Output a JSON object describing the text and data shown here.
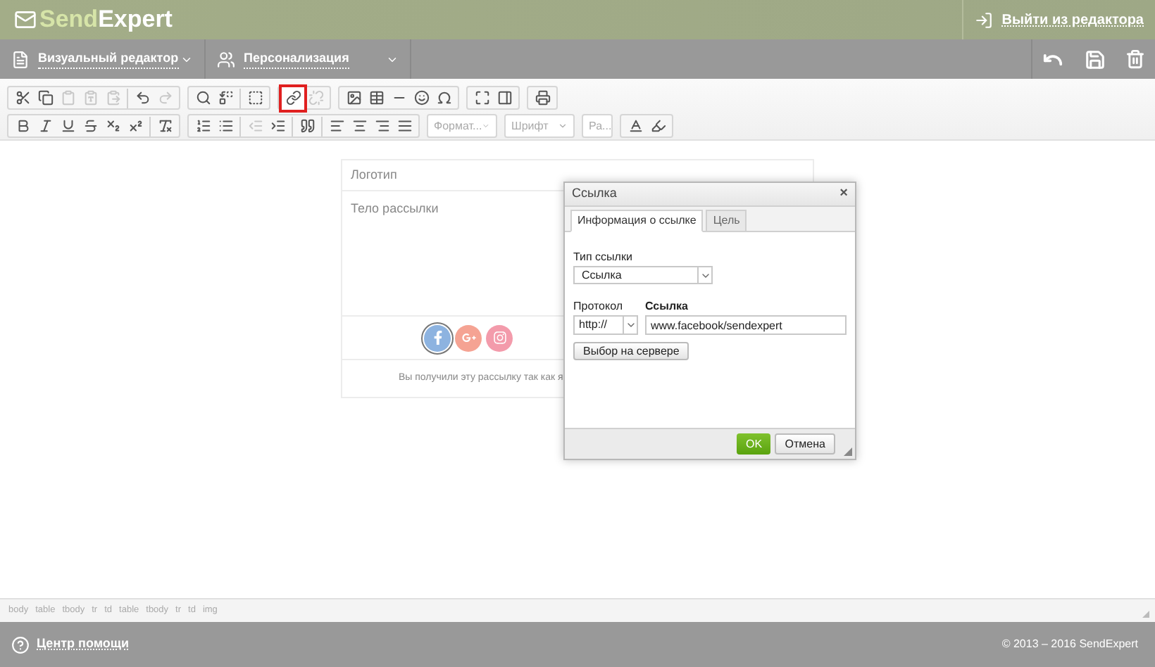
{
  "header": {
    "brand_prefix": "Send",
    "brand_suffix": "Expert",
    "exit_link": "Выйти из редактора"
  },
  "menu_bar": {
    "items": [
      {
        "kind": "editor",
        "label": "Визуальный редактор"
      },
      {
        "kind": "people",
        "label": "Персонализация"
      }
    ]
  },
  "toolbar": {
    "rows": [
      [
        {
          "items": [
            {
              "kind": "cut",
              "disabled": false,
              "selected": false
            },
            {
              "kind": "copy",
              "disabled": false,
              "selected": false
            },
            {
              "kind": "paste",
              "disabled": true,
              "selected": false
            },
            {
              "kind": "paste-text",
              "disabled": true,
              "selected": false
            },
            {
              "kind": "paste-word",
              "disabled": true,
              "selected": false
            },
            {
              "kind": "sep"
            },
            {
              "kind": "undo",
              "disabled": false,
              "selected": false
            },
            {
              "kind": "redo",
              "disabled": true,
              "selected": false
            }
          ]
        },
        {
          "items": [
            {
              "kind": "find",
              "disabled": false,
              "selected": false
            },
            {
              "kind": "replace",
              "disabled": false,
              "selected": false
            },
            {
              "kind": "sep"
            },
            {
              "kind": "select-all",
              "disabled": false,
              "selected": false
            }
          ]
        },
        {
          "items": [
            {
              "kind": "link",
              "disabled": false,
              "selected": true
            },
            {
              "kind": "unlink",
              "disabled": true,
              "selected": false
            }
          ]
        },
        {
          "items": [
            {
              "kind": "image",
              "disabled": false,
              "selected": false
            },
            {
              "kind": "table",
              "disabled": false,
              "selected": false
            },
            {
              "kind": "hr",
              "disabled": false,
              "selected": false
            },
            {
              "kind": "smiley",
              "disabled": false,
              "selected": false
            },
            {
              "kind": "omega",
              "disabled": false,
              "selected": false
            }
          ]
        },
        {
          "items": [
            {
              "kind": "maximize",
              "disabled": false,
              "selected": false
            },
            {
              "kind": "blocks",
              "disabled": false,
              "selected": false
            }
          ]
        },
        {
          "items": [
            {
              "kind": "print",
              "disabled": false,
              "selected": false
            }
          ]
        }
      ],
      [
        {
          "items": [
            {
              "kind": "bold",
              "disabled": false,
              "selected": false
            },
            {
              "kind": "italic",
              "disabled": false,
              "selected": false
            },
            {
              "kind": "underline",
              "disabled": false,
              "selected": false
            },
            {
              "kind": "strike",
              "disabled": false,
              "selected": false
            },
            {
              "kind": "sub",
              "disabled": false,
              "selected": false
            },
            {
              "kind": "sup",
              "disabled": false,
              "selected": false
            },
            {
              "kind": "sep"
            },
            {
              "kind": "clear",
              "disabled": false,
              "selected": false
            }
          ]
        },
        {
          "items": [
            {
              "kind": "ol",
              "disabled": false,
              "selected": false
            },
            {
              "kind": "ul",
              "disabled": false,
              "selected": false
            },
            {
              "kind": "sep"
            },
            {
              "kind": "outdent",
              "disabled": true,
              "selected": false
            },
            {
              "kind": "indent",
              "disabled": false,
              "selected": false
            },
            {
              "kind": "sep"
            },
            {
              "kind": "quote",
              "disabled": false,
              "selected": false
            },
            {
              "kind": "sep"
            },
            {
              "kind": "align-left",
              "disabled": false,
              "selected": false
            },
            {
              "kind": "align-center",
              "disabled": false,
              "selected": false
            },
            {
              "kind": "align-right",
              "disabled": false,
              "selected": false
            },
            {
              "kind": "align-justify",
              "disabled": false,
              "selected": false
            }
          ]
        },
        {
          "dropdown": "Формат..."
        },
        {
          "dropdown": "Шрифт"
        },
        {
          "dropdown": "Ра..."
        },
        {
          "items": [
            {
              "kind": "text-color",
              "disabled": false,
              "selected": false
            },
            {
              "kind": "bg-color",
              "disabled": false,
              "selected": false
            }
          ]
        }
      ]
    ]
  },
  "email": {
    "logo_row": "Логотип",
    "body_row": "Тело рассылки",
    "social_icons": [
      {
        "kind": "facebook",
        "selected": true
      },
      {
        "kind": "google-plus",
        "selected": false
      },
      {
        "kind": "instagram",
        "selected": false
      }
    ],
    "footer_text": "Вы получили эту рассылку так как я"
  },
  "dialog": {
    "title": "Ссылка",
    "close": "×",
    "tabs": [
      {
        "label": "Информация о ссылке",
        "selected": true
      },
      {
        "label": "Цель",
        "selected": false
      }
    ],
    "link_type_label": "Тип ссылки",
    "link_type_value": "Ссылка",
    "protocol_label": "Протокол",
    "protocol_value": "http://",
    "url_label": "Ссылка",
    "url_value": "www.facebook/sendexpert",
    "browse_button": "Выбор на сервере",
    "ok_button": "OK",
    "cancel_button": "Отмена"
  },
  "element_path": [
    "body",
    "table",
    "tbody",
    "tr",
    "td",
    "table",
    "tbody",
    "tr",
    "td",
    "img"
  ],
  "footer": {
    "help_link": "Центр помощи",
    "copyright": "© 2013 – 2016 SendExpert"
  }
}
